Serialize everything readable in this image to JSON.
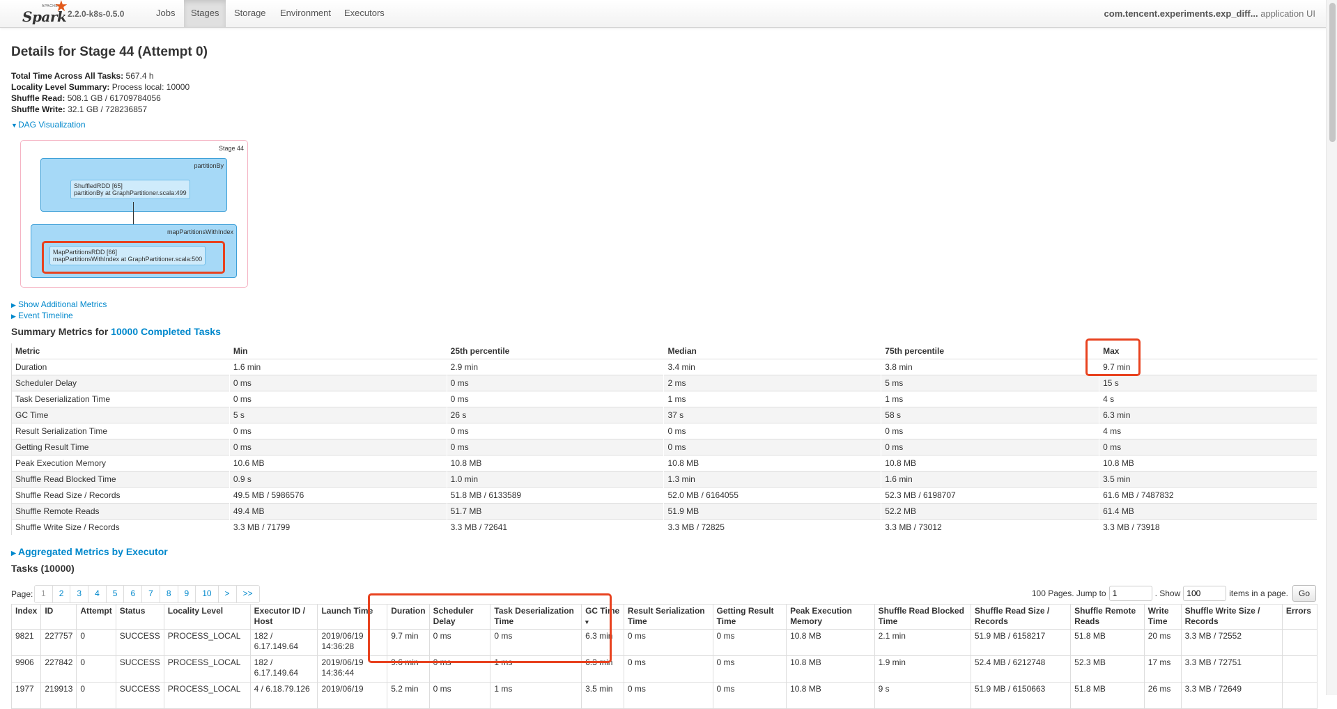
{
  "nav": {
    "logo_text": "Spark",
    "logo_small": "APACHE",
    "version": "2.2.0-k8s-0.5.0",
    "tabs": [
      "Jobs",
      "Stages",
      "Storage",
      "Environment",
      "Executors"
    ],
    "active_tab": "Stages",
    "app_name": "com.tencent.experiments.exp_diff...",
    "app_suffix": " application UI"
  },
  "page": {
    "title": "Details for Stage 44 (Attempt 0)",
    "summary": [
      {
        "label": "Total Time Across All Tasks:",
        "value": "567.4 h"
      },
      {
        "label": "Locality Level Summary:",
        "value": "Process local: 10000"
      },
      {
        "label": "Shuffle Read:",
        "value": "508.1 GB / 61709784056"
      },
      {
        "label": "Shuffle Write:",
        "value": "32.1 GB / 728236857"
      }
    ],
    "dag_toggle": "DAG Visualization",
    "additional_metrics": "Show Additional Metrics",
    "event_timeline": "Event Timeline"
  },
  "dag": {
    "stage_label": "Stage 44",
    "cluster1_label": "partitionBy",
    "node1_line1": "ShuffledRDD [65]",
    "node1_line2": "partitionBy at GraphPartitioner.scala:499",
    "cluster2_label": "mapPartitionsWithIndex",
    "node2_line1": "MapPartitionsRDD [66]",
    "node2_line2": "mapPartitionsWithIndex at GraphPartitioner.scala:500"
  },
  "summary_metrics": {
    "title_prefix": "Summary Metrics for ",
    "title_link": "10000 Completed Tasks",
    "headers": [
      "Metric",
      "Min",
      "25th percentile",
      "Median",
      "75th percentile",
      "Max"
    ],
    "rows": [
      [
        "Duration",
        "1.6 min",
        "2.9 min",
        "3.4 min",
        "3.8 min",
        "9.7 min"
      ],
      [
        "Scheduler Delay",
        "0 ms",
        "0 ms",
        "2 ms",
        "5 ms",
        "15 s"
      ],
      [
        "Task Deserialization Time",
        "0 ms",
        "0 ms",
        "1 ms",
        "1 ms",
        "4 s"
      ],
      [
        "GC Time",
        "5 s",
        "26 s",
        "37 s",
        "58 s",
        "6.3 min"
      ],
      [
        "Result Serialization Time",
        "0 ms",
        "0 ms",
        "0 ms",
        "0 ms",
        "4 ms"
      ],
      [
        "Getting Result Time",
        "0 ms",
        "0 ms",
        "0 ms",
        "0 ms",
        "0 ms"
      ],
      [
        "Peak Execution Memory",
        "10.6 MB",
        "10.8 MB",
        "10.8 MB",
        "10.8 MB",
        "10.8 MB"
      ],
      [
        "Shuffle Read Blocked Time",
        "0.9 s",
        "1.0 min",
        "1.3 min",
        "1.6 min",
        "3.5 min"
      ],
      [
        "Shuffle Read Size / Records",
        "49.5 MB / 5986576",
        "51.8 MB / 6133589",
        "52.0 MB / 6164055",
        "52.3 MB / 6198707",
        "61.6 MB / 7487832"
      ],
      [
        "Shuffle Remote Reads",
        "49.4 MB",
        "51.7 MB",
        "51.9 MB",
        "52.2 MB",
        "61.4 MB"
      ],
      [
        "Shuffle Write Size / Records",
        "3.3 MB / 71799",
        "3.3 MB / 72641",
        "3.3 MB / 72825",
        "3.3 MB / 73012",
        "3.3 MB / 73918"
      ]
    ]
  },
  "aggregated": "Aggregated Metrics by Executor",
  "tasks": {
    "title": "Tasks (10000)",
    "page_label": "Page:",
    "pages": [
      "1",
      "2",
      "3",
      "4",
      "5",
      "6",
      "7",
      "8",
      "9",
      "10",
      ">",
      ">>"
    ],
    "current_page": "1",
    "jump_text": "100 Pages. Jump to",
    "jump_value": "1",
    "show_text": ". Show",
    "show_value": "100",
    "items_text": "items in a page.",
    "go_label": "Go",
    "headers": [
      "Index",
      "ID",
      "Attempt",
      "Status",
      "Locality Level",
      "Executor ID / Host",
      "Launch Time",
      "Duration",
      "Scheduler Delay",
      "Task Deserialization Time",
      "GC Time",
      "Result Serialization Time",
      "Getting Result Time",
      "Peak Execution Memory",
      "Shuffle Read Blocked Time",
      "Shuffle Read Size / Records",
      "Shuffle Remote Reads",
      "Write Time",
      "Shuffle Write Size / Records",
      "Errors"
    ],
    "sort_arrow": "▾",
    "rows": [
      [
        "9821",
        "227757",
        "0",
        "SUCCESS",
        "PROCESS_LOCAL",
        "182 / 6.17.149.64",
        "2019/06/19 14:36:28",
        "9.7 min",
        "0 ms",
        "0 ms",
        "6.3 min",
        "0 ms",
        "0 ms",
        "10.8 MB",
        "2.1 min",
        "51.9 MB / 6158217",
        "51.8 MB",
        "20 ms",
        "3.3 MB / 72552",
        ""
      ],
      [
        "9906",
        "227842",
        "0",
        "SUCCESS",
        "PROCESS_LOCAL",
        "182 / 6.17.149.64",
        "2019/06/19 14:36:44",
        "9.6 min",
        "0 ms",
        "1 ms",
        "6.3 min",
        "0 ms",
        "0 ms",
        "10.8 MB",
        "1.9 min",
        "52.4 MB / 6212748",
        "52.3 MB",
        "17 ms",
        "3.3 MB / 72751",
        ""
      ],
      [
        "1977",
        "219913",
        "0",
        "SUCCESS",
        "PROCESS_LOCAL",
        "4 / 6.18.79.126",
        "2019/06/19",
        "5.2 min",
        "0 ms",
        "1 ms",
        "3.5 min",
        "0 ms",
        "0 ms",
        "10.8 MB",
        "9 s",
        "51.9 MB / 6150663",
        "51.8 MB",
        "26 ms",
        "3.3 MB / 72649",
        ""
      ]
    ]
  }
}
